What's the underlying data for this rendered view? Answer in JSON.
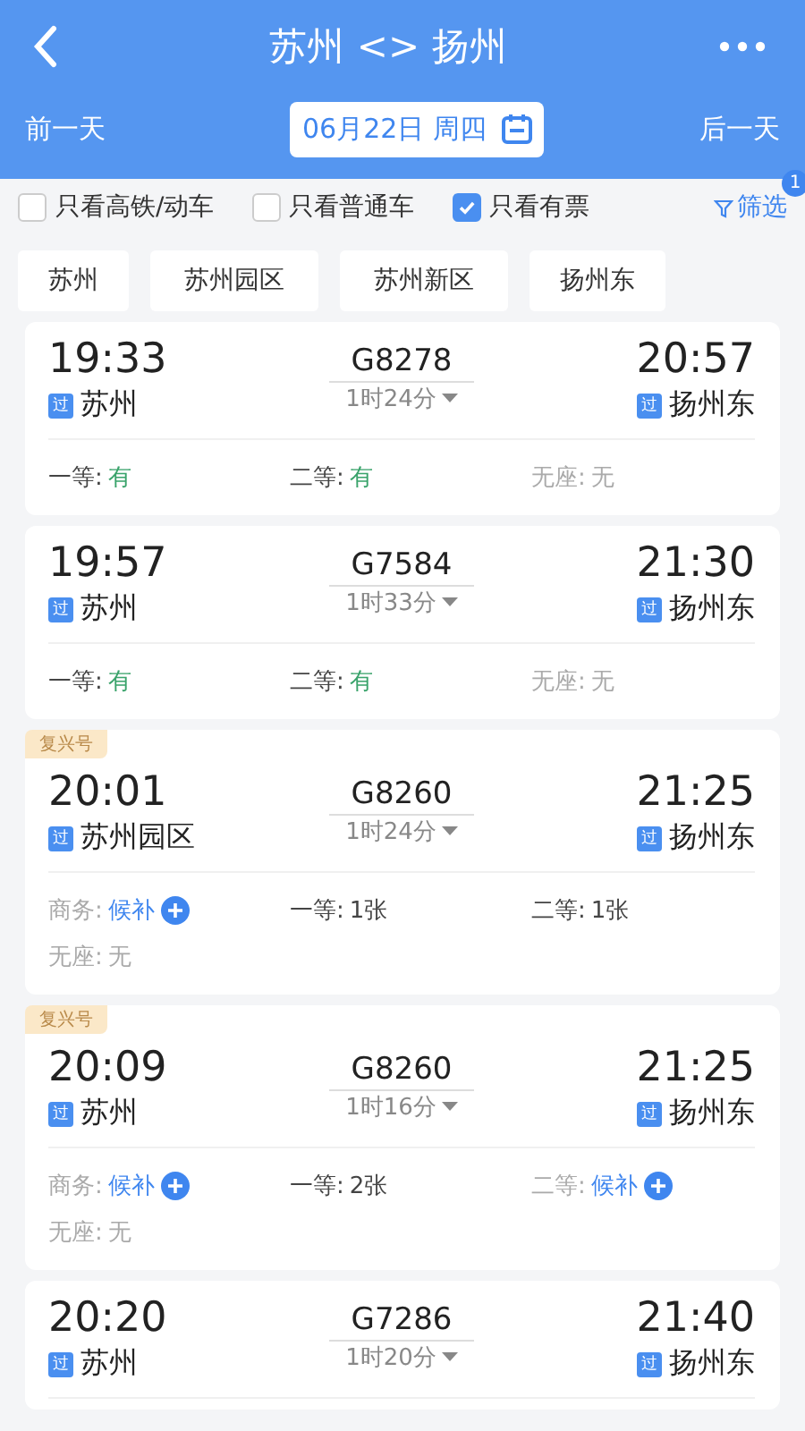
{
  "header": {
    "title": "苏州 <> 扬州",
    "prev_day": "前一天",
    "date": "06月22日 周四",
    "next_day": "后一天"
  },
  "filters": [
    {
      "label": "只看高铁/动车",
      "checked": false
    },
    {
      "label": "只看普通车",
      "checked": false
    },
    {
      "label": "只看有票",
      "checked": true
    }
  ],
  "filter_button": {
    "label": "筛选",
    "badge": "1"
  },
  "stations": [
    {
      "label": "苏州"
    },
    {
      "label": "苏州园区"
    },
    {
      "label": "苏州新区"
    },
    {
      "label": "扬州东"
    }
  ],
  "trains": [
    {
      "depart_time": "19:33",
      "depart_station": "苏州",
      "depart_tag": "过",
      "number": "G8278",
      "duration": "1时24分",
      "arrive_time": "20:57",
      "arrive_station": "扬州东",
      "arrive_tag": "过",
      "seats": [
        {
          "label": "一等:",
          "value": "有",
          "kind": "available"
        },
        {
          "label": "二等:",
          "value": "有",
          "kind": "available"
        },
        {
          "label": "无座:",
          "value": "无",
          "kind": "none"
        }
      ]
    },
    {
      "depart_time": "19:57",
      "depart_station": "苏州",
      "depart_tag": "过",
      "number": "G7584",
      "duration": "1时33分",
      "arrive_time": "21:30",
      "arrive_station": "扬州东",
      "arrive_tag": "过",
      "seats": [
        {
          "label": "一等:",
          "value": "有",
          "kind": "available"
        },
        {
          "label": "二等:",
          "value": "有",
          "kind": "available"
        },
        {
          "label": "无座:",
          "value": "无",
          "kind": "none"
        }
      ]
    },
    {
      "ribbon": "复兴号",
      "depart_time": "20:01",
      "depart_station": "苏州园区",
      "depart_tag": "过",
      "number": "G8260",
      "duration": "1时24分",
      "arrive_time": "21:25",
      "arrive_station": "扬州东",
      "arrive_tag": "过",
      "seats": [
        {
          "label": "商务:",
          "value": "候补",
          "kind": "waitlist"
        },
        {
          "label": "一等:",
          "value": "1张",
          "kind": "count"
        },
        {
          "label": "二等:",
          "value": "1张",
          "kind": "count"
        },
        {
          "label": "无座:",
          "value": "无",
          "kind": "none"
        }
      ]
    },
    {
      "ribbon": "复兴号",
      "depart_time": "20:09",
      "depart_station": "苏州",
      "depart_tag": "过",
      "number": "G8260",
      "duration": "1时16分",
      "arrive_time": "21:25",
      "arrive_station": "扬州东",
      "arrive_tag": "过",
      "seats": [
        {
          "label": "商务:",
          "value": "候补",
          "kind": "waitlist"
        },
        {
          "label": "一等:",
          "value": "2张",
          "kind": "count"
        },
        {
          "label": "二等:",
          "value": "候补",
          "kind": "waitlist"
        },
        {
          "label": "无座:",
          "value": "无",
          "kind": "none"
        }
      ]
    },
    {
      "depart_time": "20:20",
      "depart_station": "苏州",
      "depart_tag": "过",
      "number": "G7286",
      "duration": "1时20分",
      "arrive_time": "21:40",
      "arrive_station": "扬州东",
      "arrive_tag": "过"
    }
  ]
}
